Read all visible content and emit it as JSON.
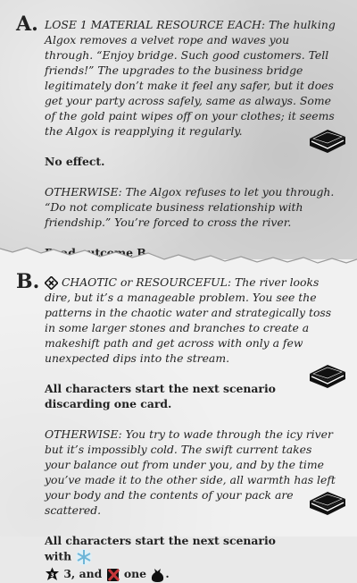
{
  "outcome_a": {
    "letter": "A.",
    "condition": "LOSE 1 MATERIAL RESOURCE EACH:",
    "narrative": " The hulking Algox removes a velvet rope and waves you through. “Enjoy bridge. Such good customers. Tell friends!” The upgrades to the business bridge legitimately don’t make it feel any safer, but it does get your party across safely, same as always. Some of the gold paint wipes off on your clothes; it seems the Algox is reapplying it regularly.",
    "effect": "No effect.",
    "otherwise_label": "OTHERWISE:",
    "otherwise_text": " The Algox refuses to let you through. “Do not complicate business relationship with friendship.” You’re forced to cross the river.",
    "otherwise_effect": "Read outcome B."
  },
  "outcome_b": {
    "letter": "B.",
    "condition_icon": "chaotic-trait-icon",
    "condition": "CHAOTIC",
    "condition_or": " or ",
    "condition2": "RESOURCEFUL:",
    "narrative": " The river looks dire, but it’s a manageable problem. You see the patterns in the chaotic water and strategically toss in some larger stones and branches to create a makeshift path and get across with only a few unexpected dips into the stream.",
    "effect": "All characters start the next scenario discarding one card.",
    "otherwise_label": "OTHERWISE:",
    "otherwise_text": " You try to wade through the icy river but it’s impossibly cold. The swift current takes your balance out from under you, and by the time you’ve made it to the other side, all warmth has left your body and the contents of your pack are scattered.",
    "otherwise_effect_prefix": "All characters start the next scenario with",
    "otherwise_effect_mid1": " 3, and ",
    "otherwise_effect_mid2": " one ",
    "otherwise_effect_suffix": ".",
    "icons": [
      "frost-icon",
      "damage-3-icon",
      "lose-x-icon",
      "item-sack-icon"
    ]
  },
  "colors": {
    "top_card": "#d6d6d6",
    "bottom_card": "#f1f1f1",
    "frost": "#6fb6d8",
    "lose_red": "#c8373a"
  }
}
